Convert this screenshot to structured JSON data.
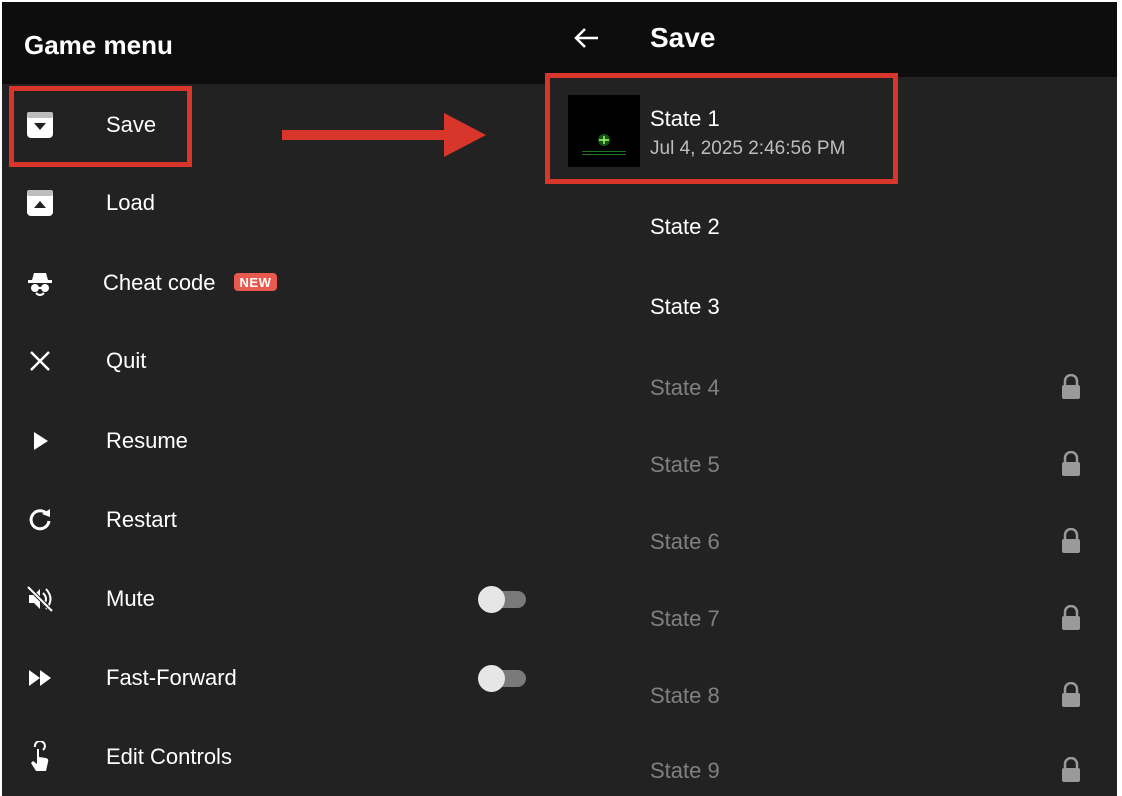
{
  "left_panel": {
    "title": "Game menu",
    "items": [
      {
        "label": "Save",
        "icon": "save-icon"
      },
      {
        "label": "Load",
        "icon": "load-icon"
      },
      {
        "label": "Cheat code",
        "icon": "spy-icon",
        "badge": "NEW"
      },
      {
        "label": "Quit",
        "icon": "close-icon"
      },
      {
        "label": "Resume",
        "icon": "play-icon"
      },
      {
        "label": "Restart",
        "icon": "restart-icon"
      },
      {
        "label": "Mute",
        "icon": "mute-icon",
        "toggle": false
      },
      {
        "label": "Fast-Forward",
        "icon": "fast-forward-icon",
        "toggle": false
      },
      {
        "label": "Edit Controls",
        "icon": "touch-icon"
      }
    ]
  },
  "right_panel": {
    "title": "Save",
    "back_icon": "back-arrow-icon",
    "states": [
      {
        "label": "State 1",
        "timestamp": "Jul 4, 2025 2:46:56 PM",
        "locked": false,
        "has_thumbnail": true
      },
      {
        "label": "State 2",
        "locked": false
      },
      {
        "label": "State 3",
        "locked": false
      },
      {
        "label": "State 4",
        "locked": true
      },
      {
        "label": "State 5",
        "locked": true
      },
      {
        "label": "State 6",
        "locked": true
      },
      {
        "label": "State 7",
        "locked": true
      },
      {
        "label": "State 8",
        "locked": true
      },
      {
        "label": "State 9",
        "locked": true
      }
    ]
  },
  "colors": {
    "background": "#222222",
    "header": "#0d0d0d",
    "annotation": "#d8362a",
    "badge": "#e85a4f",
    "locked_text": "#808080"
  }
}
